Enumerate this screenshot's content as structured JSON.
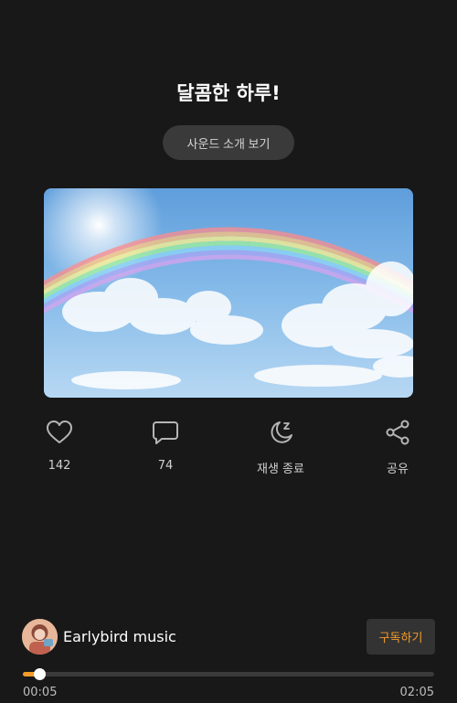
{
  "header": {
    "title": "달콤한 하루!",
    "intro_button": "사운드 소개 보기"
  },
  "actions": [
    {
      "icon": "heart-icon",
      "label": "142"
    },
    {
      "icon": "comment-icon",
      "label": "74"
    },
    {
      "icon": "sleep-moon-icon",
      "label": "재생 종료"
    },
    {
      "icon": "share-icon",
      "label": "공유"
    }
  ],
  "channel": {
    "name": "Earlybird music",
    "subscribe_label": "구독하기"
  },
  "player": {
    "current_time": "00:05",
    "total_time": "02:05",
    "progress_fraction": 0.04
  },
  "colors": {
    "accent": "#f29b28",
    "background": "#181818"
  }
}
